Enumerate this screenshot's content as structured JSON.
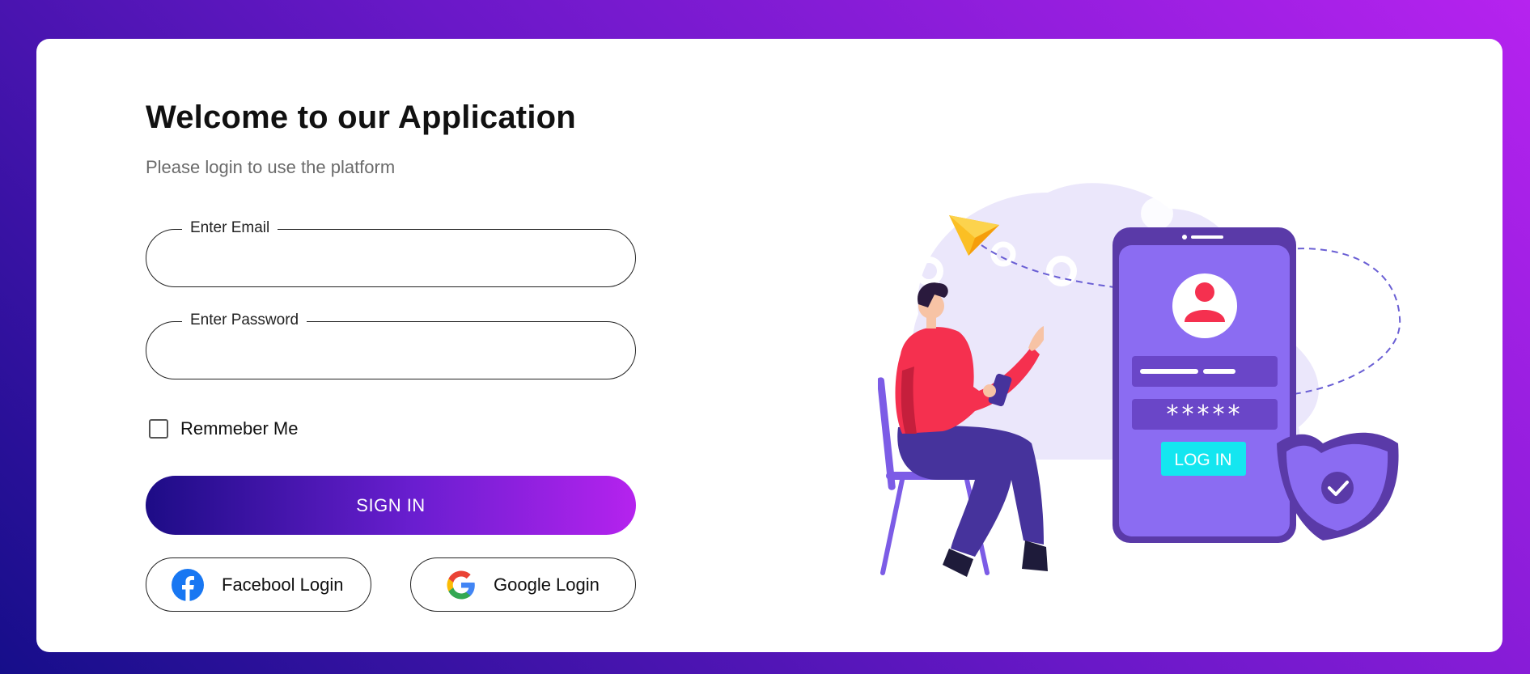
{
  "header": {
    "title": "Welcome to our Application",
    "subtitle": "Please login to use the platform"
  },
  "form": {
    "email_label": "Enter Email",
    "email_value": "",
    "password_label": "Enter Password",
    "password_value": "",
    "remember_label": "Remmeber Me",
    "remember_checked": false,
    "signin_label": "SIGN IN"
  },
  "social": {
    "facebook_label": "Facebool Login",
    "facebook_icon": "facebook-icon",
    "google_label": "Google Login",
    "google_icon": "google-icon"
  },
  "illustration": {
    "phone_button_label": "LOG IN",
    "phone_password_mask": "*****"
  },
  "colors": {
    "gradient_start": "#160e8a",
    "gradient_end": "#b623ef",
    "phone_purple": "#8b6cf2",
    "accent_red": "#f5304f",
    "login_button_cyan": "#14e6f0"
  }
}
